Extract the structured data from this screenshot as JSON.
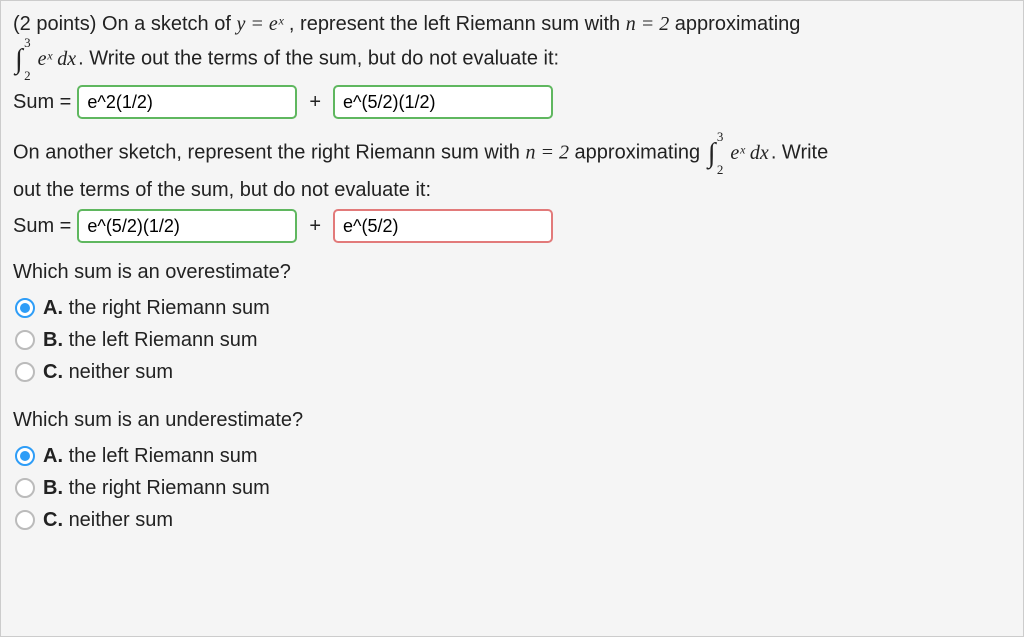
{
  "question": {
    "points_prefix": "(2 points) ",
    "line1_a": "On a sketch of ",
    "eq1": "y = eˣ",
    "line1_b": " , represent the left Riemann sum with ",
    "n_eq": "n = 2",
    "line1_c": " approximating",
    "integral": {
      "upper": "3",
      "lower": "2",
      "body": "eˣ dx"
    },
    "line2_tail": ". Write out the terms of the sum, but do not evaluate it:",
    "sum_label": "Sum =",
    "plus": "+",
    "input1": "e^2(1/2)",
    "input2": "e^(5/2)(1/2)"
  },
  "question2": {
    "line1_a": "On another sketch, represent the right Riemann sum with ",
    "n_eq": "n = 2",
    "line1_b": " approximating ",
    "integral": {
      "upper": "3",
      "lower": "2",
      "body": "eˣ dx"
    },
    "line1_tail": ". Write",
    "line2": "out the terms of the sum, but do not evaluate it:",
    "sum_label": "Sum =",
    "plus": "+",
    "input1": "e^(5/2)(1/2)",
    "input2": "e^(5/2)"
  },
  "q_over": {
    "prompt": "Which sum is an overestimate?",
    "options": [
      {
        "letter": "A.",
        "text": "the right Riemann sum",
        "selected": true
      },
      {
        "letter": "B.",
        "text": "the left Riemann sum",
        "selected": false
      },
      {
        "letter": "C.",
        "text": "neither sum",
        "selected": false
      }
    ]
  },
  "q_under": {
    "prompt": "Which sum is an underestimate?",
    "options": [
      {
        "letter": "A.",
        "text": "the left Riemann sum",
        "selected": true
      },
      {
        "letter": "B.",
        "text": "the right Riemann sum",
        "selected": false
      },
      {
        "letter": "C.",
        "text": "neither sum",
        "selected": false
      }
    ]
  }
}
